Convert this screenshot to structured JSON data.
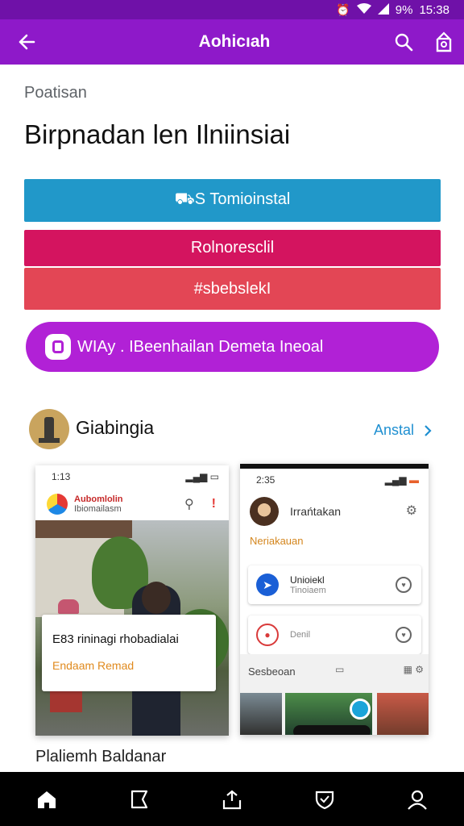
{
  "status_bar": {
    "time": "15:38",
    "battery": "9%",
    "icons": [
      "alarm-icon",
      "wifi-icon",
      "signal-icon"
    ]
  },
  "app_bar": {
    "title": "Aohicıah",
    "icons": [
      "back-arrow-icon",
      "search-icon",
      "share-icon"
    ],
    "color": "#8e19c9"
  },
  "main": {
    "section_label": "Poatisan",
    "headline": "Birpnadan len Ilniinsiai",
    "buttons": [
      {
        "label": "⛟S Tomioinstal",
        "color": "#2198c9"
      },
      {
        "label": "Rolnoresclil",
        "color": "#d4145f"
      },
      {
        "label": "#sbebslekI",
        "color": "#e34655"
      }
    ],
    "pill_button": {
      "label": "WIAy . IBeenhailan Demeta Ineoal",
      "color": "#b121d6"
    }
  },
  "profile": {
    "name": "Giabingia",
    "see_all": "Anstal",
    "avatar_icon": "lighthouse-icon"
  },
  "screenshot1": {
    "time": "1:13",
    "brand": "Aubomlolin",
    "brand_sub": "Ibiomailasm",
    "card_title": "E83 rininagi rhobadialai",
    "card_subtitle": "Endaam Remad"
  },
  "screenshot2": {
    "time": "2:35",
    "profile_name": "Irrańtakan",
    "profile_sub": "Neriakauan",
    "item1_title": "Unioiekl",
    "item1_sub": "Tinoiaem",
    "item2_title": "Denil",
    "section": "Sesbeoan"
  },
  "caption": "Plaliemh Baldanar",
  "bottom_nav": [
    "home-icon",
    "bookmark-icon",
    "upload-icon",
    "shield-icon",
    "profile-icon"
  ]
}
